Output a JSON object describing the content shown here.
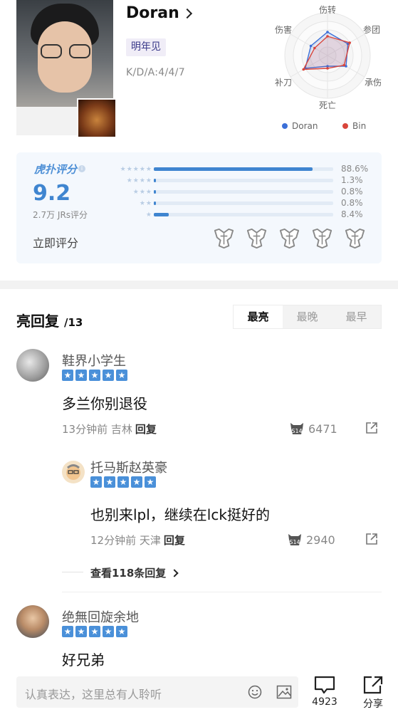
{
  "player": {
    "name": "Doran",
    "tag": "明年见",
    "kda": "K/D/A:4/4/7"
  },
  "radar": {
    "axes": [
      "伤转",
      "参团",
      "承伤",
      "死亡",
      "补刀",
      "伤害"
    ],
    "legend": [
      {
        "name": "Doran",
        "color": "#3b6fd8"
      },
      {
        "name": "Bin",
        "color": "#d9453b"
      }
    ],
    "series": [
      {
        "name": "Doran",
        "values": [
          0.55,
          0.55,
          0.5,
          0.25,
          0.6,
          0.45
        ]
      },
      {
        "name": "Bin",
        "values": [
          0.45,
          0.6,
          0.45,
          0.3,
          0.65,
          0.35
        ]
      }
    ]
  },
  "rating": {
    "brand": "虎扑评分",
    "score": "9.2",
    "count": "2.7万 JRs评分",
    "rate_now": "立即评分",
    "distribution": [
      {
        "stars": "★★★★★",
        "pct": "88.6%",
        "value": 88.6
      },
      {
        "stars": "★★★★",
        "pct": "1.3%",
        "value": 1.3
      },
      {
        "stars": "★★★",
        "pct": "0.8%",
        "value": 0.8
      },
      {
        "stars": "★★",
        "pct": "0.8%",
        "value": 0.8
      },
      {
        "stars": "★",
        "pct": "8.4%",
        "value": 8.4
      }
    ]
  },
  "replies": {
    "title": "亮回复",
    "count": "/13",
    "sort": [
      "最亮",
      "最晚",
      "最早"
    ],
    "sort_active": 0
  },
  "comments": [
    {
      "user": "鞋界小学生",
      "text": "多兰你别退役",
      "meta": "13分钟前 吉林",
      "reply_label": "回复",
      "likes": "6471",
      "stars": 5
    },
    {
      "user": "托马斯赵英豪",
      "text": "也别来lpl，继续在lck挺好的",
      "meta": "12分钟前 天津",
      "reply_label": "回复",
      "likes": "2940",
      "stars": 5
    },
    {
      "user": "绝無回旋余地",
      "text": "好兄弟",
      "stars": 5
    }
  ],
  "more_replies": "查看118条回复",
  "bottom": {
    "placeholder": "认真表达，这里总有人聆听",
    "comment_count": "4923",
    "share_label": "分享"
  },
  "colors": {
    "accent": "#3f85d0",
    "star": "#4a90d9"
  }
}
